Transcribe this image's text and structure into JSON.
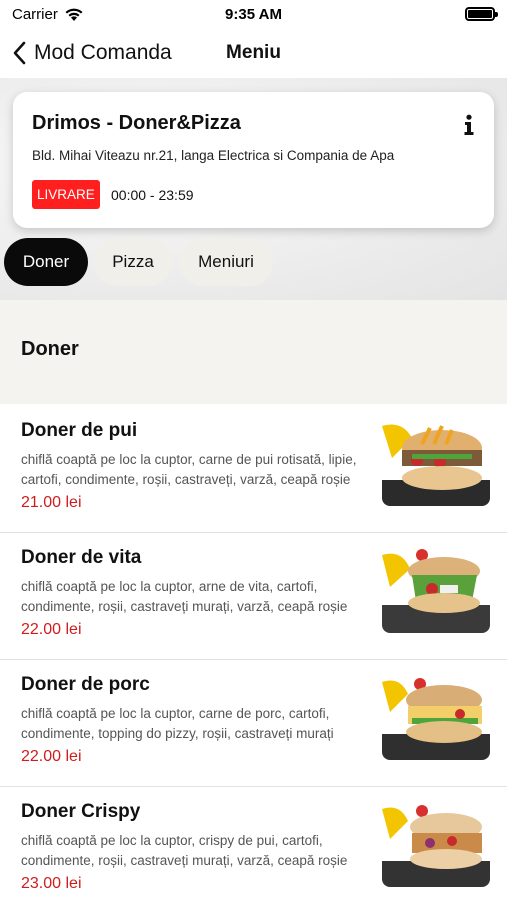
{
  "status_bar": {
    "carrier": "Carrier",
    "time": "9:35 AM",
    "battery_level": 1.0
  },
  "nav": {
    "back_label": "Mod Comanda",
    "title": "Meniu"
  },
  "restaurant": {
    "name": "Drimos - Doner&Pizza",
    "address": "Bld. Mihai Viteazu nr.21, langa Electrica si Compania de Apa",
    "delivery_label": "LIVRARE",
    "hours": "00:00 - 23:59"
  },
  "categories": [
    {
      "label": "Doner",
      "active": true
    },
    {
      "label": "Pizza",
      "active": false
    },
    {
      "label": "Meniuri",
      "active": false
    }
  ],
  "section": {
    "title": "Doner"
  },
  "items": [
    {
      "name": "Doner de pui",
      "description": "chiflă coaptă pe loc la cuptor, carne de pui rotisată, lipie, cartofi, condimente, roșii, castraveți, varză, ceapă roșie",
      "price": "21.00 lei"
    },
    {
      "name": "Doner de vita",
      "description": "chiflă coaptă pe loc la cuptor, arne de vita, cartofi, condimente, roșii, castraveți murați, varză, ceapă roșie",
      "price": "22.00 lei"
    },
    {
      "name": "Doner de porc",
      "description": "chiflă coaptă pe loc la cuptor, carne de porc, cartofi, condimente, topping do pizzy, roșii, castraveți murați",
      "price": "22.00 lei"
    },
    {
      "name": "Doner Crispy",
      "description": "chiflă coaptă pe loc la cuptor, crispy de pui,  cartofi, condimente, roșii, castraveți murați, varză, ceapă roșie",
      "price": "23.00 lei"
    }
  ],
  "colors": {
    "accent_red": "#d01c1c",
    "badge_red": "#ff1f1f",
    "chip_active": "#0a0a0a",
    "chip_inactive": "#f1efea"
  }
}
